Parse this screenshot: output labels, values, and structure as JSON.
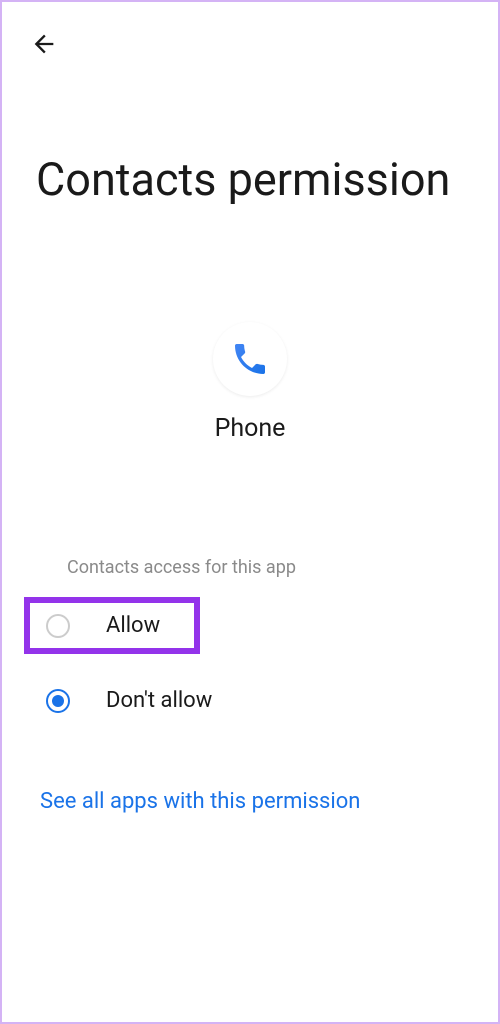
{
  "header": {
    "title": "Contacts permission"
  },
  "app": {
    "name": "Phone",
    "icon": "phone-icon"
  },
  "section": {
    "label": "Contacts access for this app"
  },
  "options": {
    "allow": {
      "label": "Allow",
      "selected": false,
      "highlighted": true
    },
    "dont_allow": {
      "label": "Don't allow",
      "selected": true,
      "highlighted": false
    }
  },
  "footer": {
    "link": "See all apps with this permission"
  }
}
